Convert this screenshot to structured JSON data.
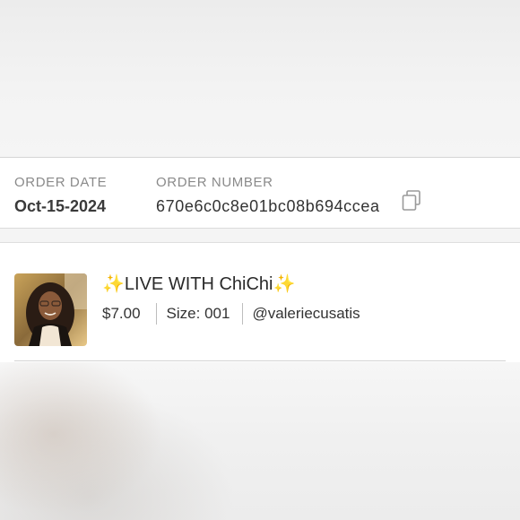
{
  "order": {
    "date_label": "ORDER DATE",
    "date_value": "Oct-15-2024",
    "number_label": "ORDER NUMBER",
    "number_value": "670e6c0c8e01bc08b694ccea",
    "copy_icon": "copy-icon"
  },
  "item": {
    "title_prefix": "✨",
    "title_text": "LIVE WITH ChiChi",
    "title_suffix": "✨",
    "price": "$7.00",
    "size": "Size: 001",
    "seller": "@valeriecusatis"
  },
  "colors": {
    "label_gray": "#8a8a8a",
    "text_dark": "#333333",
    "sparkle_gold": "#e8c33a",
    "divider": "#d4d4d4"
  }
}
